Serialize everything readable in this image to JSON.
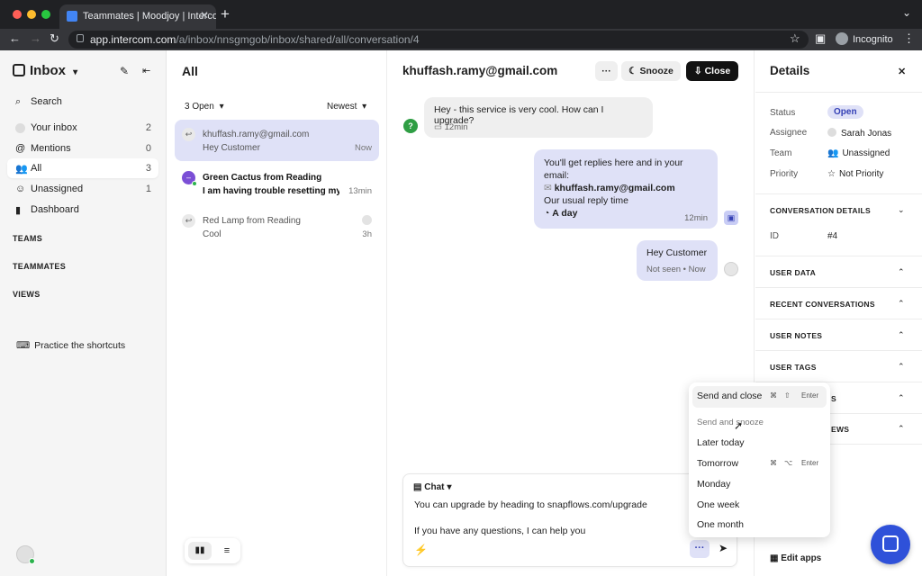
{
  "browser": {
    "tab_title": "Teammates | Moodjoy | Intercom",
    "tab_close": "✕",
    "url_host": "app.intercom.com",
    "url_path": "/a/inbox/nnsgmgob/inbox/shared/all/conversation/4",
    "incognito_label": "Incognito",
    "colors": {
      "close": "#ff5f57",
      "minimize": "#febc2e",
      "maximize": "#28c840"
    }
  },
  "sidebar": {
    "title": "Inbox",
    "items": [
      {
        "label": "Search",
        "count": "",
        "icon": "search-icon"
      },
      {
        "label": "Your inbox",
        "count": "2",
        "icon": "avatar-icon"
      },
      {
        "label": "Mentions",
        "count": "0",
        "icon": "at-icon"
      },
      {
        "label": "All",
        "count": "3",
        "icon": "people-icon"
      },
      {
        "label": "Unassigned",
        "count": "1",
        "icon": "unassigned-icon"
      },
      {
        "label": "Dashboard",
        "count": "",
        "icon": "chart-icon"
      }
    ],
    "sections": [
      "TEAMS",
      "TEAMMATES",
      "VIEWS"
    ],
    "shortcuts_label": "Practice the shortcuts"
  },
  "conversation_list": {
    "title": "All",
    "filter_open": "3 Open",
    "sort": "Newest",
    "conversations": [
      {
        "name": "khuffash.ramy@gmail.com",
        "preview": "Hey Customer",
        "time": "Now"
      },
      {
        "name": "Green Cactus from Reading",
        "preview": "I am having trouble resetting my ...",
        "time": "13min"
      },
      {
        "name": "Red Lamp from Reading",
        "preview": "Cool",
        "time": "3h"
      }
    ]
  },
  "conversation": {
    "title": "khuffash.ramy@gmail.com",
    "more_label": "···",
    "snooze_label": "Snooze",
    "close_label": "Close",
    "messages": [
      {
        "text": "Hey - this service is very cool. How can I upgrade?",
        "time": "12min"
      },
      {
        "line1": "You'll get replies here and in your email:",
        "email": "khuffash.ramy@gmail.com",
        "line3": "Our usual reply time",
        "reply_time": "A day",
        "time": "12min"
      },
      {
        "text": "Hey Customer",
        "status": "Not seen",
        "time": "Now"
      }
    ],
    "composer": {
      "type_label": "Chat",
      "line1": "You can upgrade by heading to snapflows.com/upgrade",
      "line2": "If you have any questions, I can help you"
    },
    "send_menu": {
      "send_and_close": "Send and close",
      "send_and_close_keys": [
        "⌘",
        "⇧",
        "Enter"
      ],
      "send_and_snooze": "Send and snooze",
      "options": [
        "Later today",
        "Tomorrow",
        "Monday",
        "One week",
        "One month"
      ],
      "tomorrow_keys": [
        "⌘",
        "⌥",
        "Enter"
      ]
    }
  },
  "details": {
    "title": "Details",
    "rows": [
      {
        "label": "Status",
        "value": "Open"
      },
      {
        "label": "Assignee",
        "value": "Sarah Jonas"
      },
      {
        "label": "Team",
        "value": "Unassigned"
      },
      {
        "label": "Priority",
        "value": "Not Priority"
      }
    ],
    "conversation_details": "CONVERSATION DETAILS",
    "id_label": "ID",
    "id_value": "#4",
    "sections": [
      "USER DATA",
      "RECENT CONVERSATIONS",
      "USER NOTES",
      "USER TAGS"
    ],
    "partial_section_1": "S",
    "partial_section_2": "EWS",
    "edit_apps": "Edit apps"
  }
}
